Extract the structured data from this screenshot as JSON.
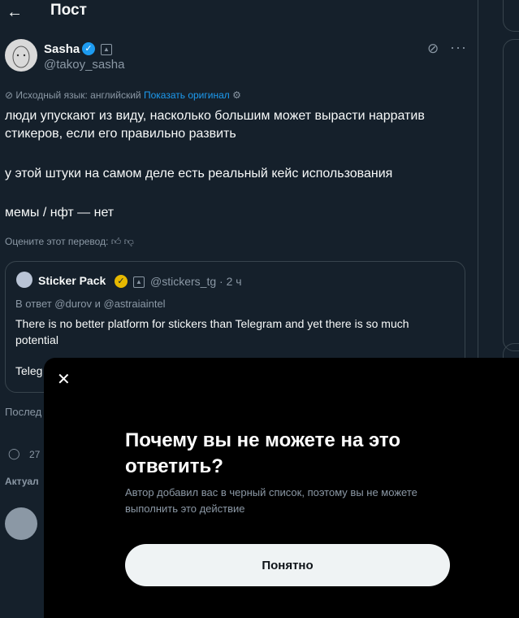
{
  "header": {
    "title": "Пост",
    "back_icon": "arrow-left-icon"
  },
  "post": {
    "author_name": "Sasha",
    "author_handle": "@takoy_sasha",
    "source_language": "Исходный язык: английский",
    "show_original": "Показать оригинал",
    "paragraph_1": "люди упускают из виду, насколько большим может вырасти нарратив стикеров, если его правильно развить",
    "paragraph_2": "у этой штуки на самом деле есть реальный кейс использования",
    "paragraph_3": "мемы / нфт — нет",
    "rate_translation": "Оцените этот перевод:"
  },
  "quote": {
    "author_name": "Sticker Pack",
    "author_handle": "@stickers_tg · 2 ч",
    "reply_to": "В ответ @durov и @astraiaintel",
    "text": "There is no better platform for stickers than Telegram and yet there is so much potential",
    "text_partial": "Teleg"
  },
  "background_fragments": {
    "last": "Послед",
    "replies_count": "27",
    "relevant": "Актуал"
  },
  "dialog": {
    "title": "Почему вы не можете на это ответить?",
    "description": "Автор добавил вас в черный список, поэтому вы не можете выполнить это действие",
    "ok_label": "Понятно"
  },
  "colors": {
    "background": "#15202b",
    "accent": "#1d9bf0",
    "dialog_bg": "#000000",
    "muted": "#8b98a5"
  }
}
